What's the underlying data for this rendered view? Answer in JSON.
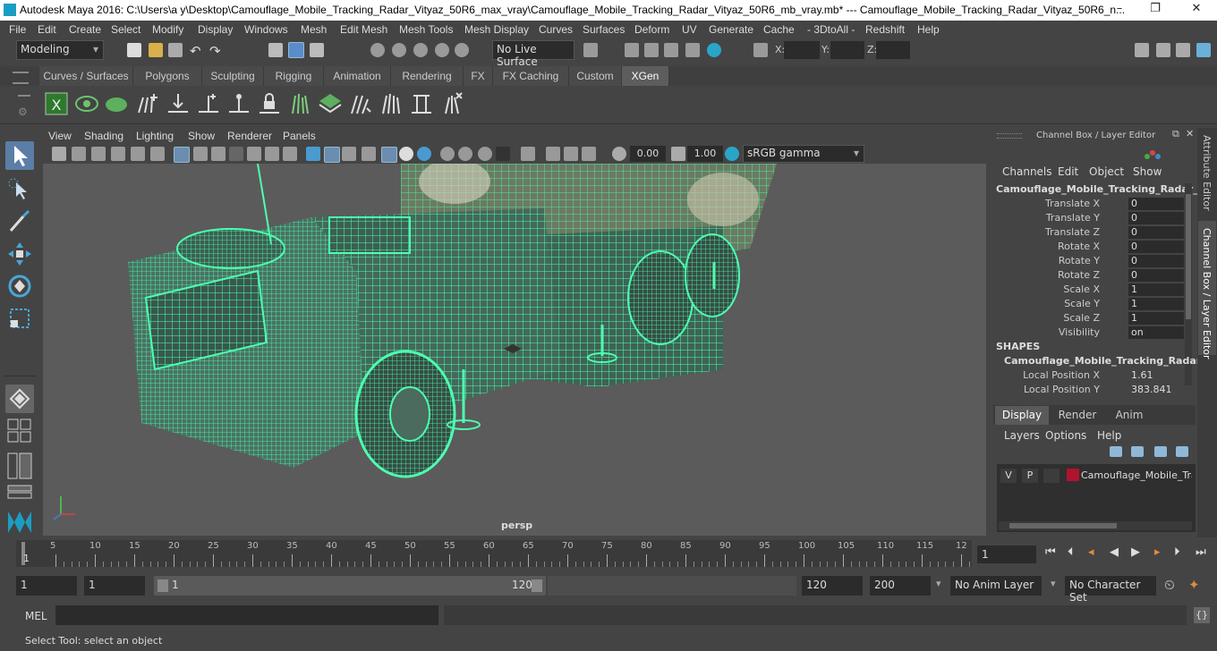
{
  "window": {
    "title": "Autodesk Maya 2016: C:\\Users\\a y\\Desktop\\Camouflage_Mobile_Tracking_Radar_Vityaz_50R6_max_vray\\Camouflage_Mobile_Tracking_Radar_Vityaz_50R6_mb_vray.mb*   ---   Camouflage_Mobile_Tracking_Radar_Vityaz_50R6_n...",
    "minimize": "–",
    "restore": "❐",
    "close": "✕"
  },
  "menubar": {
    "items": [
      "File",
      "Edit",
      "Create",
      "Select",
      "Modify",
      "Display",
      "Windows",
      "Mesh",
      "Edit Mesh",
      "Mesh Tools",
      "Mesh Display",
      "Curves",
      "Surfaces",
      "Deform",
      "UV",
      "Generate",
      "Cache",
      "- 3DtoAll -",
      "Redshift",
      "Help"
    ]
  },
  "statusline": {
    "mode": "Modeling",
    "live_surface": "No Live Surface",
    "x_label": "X:",
    "y_label": "Y:",
    "z_label": "Z:"
  },
  "shelf": {
    "tabs": [
      "Curves / Surfaces",
      "Polygons",
      "Sculpting",
      "Rigging",
      "Animation",
      "Rendering",
      "FX",
      "FX Caching",
      "Custom",
      "XGen"
    ],
    "active_tab": "XGen"
  },
  "viewport": {
    "menu": [
      "View",
      "Shading",
      "Lighting",
      "Show",
      "Renderer",
      "Panels"
    ],
    "exposure": "0.00",
    "gamma": "1.00",
    "color_space": "sRGB gamma",
    "camera_label": "persp",
    "wire_color": "#4dffb0"
  },
  "channelbox": {
    "header": "Channel Box / Layer Editor",
    "menu": [
      "Channels",
      "Edit",
      "Object",
      "Show"
    ],
    "object_name": "Camouflage_Mobile_Tracking_Radar_...",
    "attributes": [
      {
        "label": "Translate X",
        "value": "0"
      },
      {
        "label": "Translate Y",
        "value": "0"
      },
      {
        "label": "Translate Z",
        "value": "0"
      },
      {
        "label": "Rotate X",
        "value": "0"
      },
      {
        "label": "Rotate Y",
        "value": "0"
      },
      {
        "label": "Rotate Z",
        "value": "0"
      },
      {
        "label": "Scale X",
        "value": "1"
      },
      {
        "label": "Scale Y",
        "value": "1"
      },
      {
        "label": "Scale Z",
        "value": "1"
      },
      {
        "label": "Visibility",
        "value": "on"
      }
    ],
    "shapes_header": "SHAPES",
    "shape_name": "Camouflage_Mobile_Tracking_Radar...",
    "shape_attributes": [
      {
        "label": "Local Position X",
        "value": "1.61"
      },
      {
        "label": "Local Position Y",
        "value": "383.841"
      }
    ],
    "layer_tabs": [
      "Display",
      "Render",
      "Anim"
    ],
    "active_layer_tab": "Display",
    "layer_menu": [
      "Layers",
      "Options",
      "Help"
    ],
    "layer": {
      "v": "V",
      "p": "P",
      "name": "Camouflage_Mobile_Trac",
      "color": "#b0132e"
    }
  },
  "sidetabs": [
    "Attribute Editor",
    "Channel Box / Layer Editor"
  ],
  "timeline": {
    "ticks": [
      "5",
      "10",
      "15",
      "20",
      "25",
      "30",
      "35",
      "40",
      "45",
      "50",
      "55",
      "60",
      "65",
      "70",
      "75",
      "80",
      "85",
      "90",
      "95",
      "100",
      "105",
      "110",
      "115",
      "12"
    ],
    "start_marker": "1",
    "current_frame": "1"
  },
  "range": {
    "start": "1",
    "anim_start": "1",
    "slider_start": "1",
    "slider_end": "120",
    "end": "120",
    "anim_end": "200",
    "anim_layer": "No Anim Layer",
    "character_set": "No Character Set"
  },
  "cmdline": {
    "label": "MEL"
  },
  "helpline": {
    "text": "Select Tool: select an object"
  }
}
